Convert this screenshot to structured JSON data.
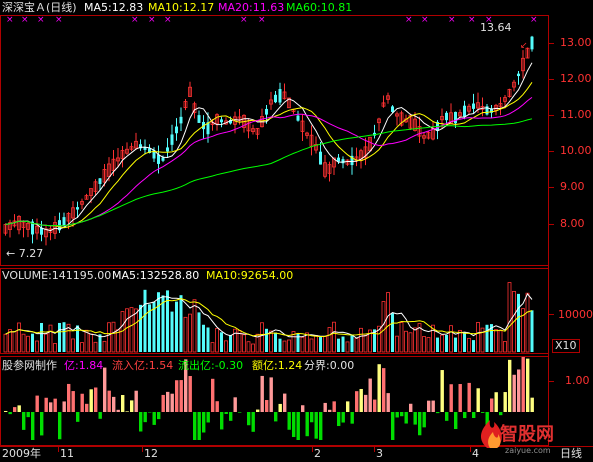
{
  "main_header": {
    "title": "深深宝Ａ(日线)",
    "ma5": "MA5:12.83",
    "ma10": "MA10:12.17",
    "ma20": "MA20:11.63",
    "ma60": "MA60:10.81"
  },
  "price_axis": [
    "13.00",
    "12.00",
    "11.00",
    "10.00",
    "9.00",
    "8.00"
  ],
  "annotations": {
    "high": "13.64",
    "low": "← 7.27"
  },
  "volume_header": {
    "volume": "VOLUME:141195.00",
    "ma5": "MA5:132528.80",
    "ma10": "MA10:92654.00"
  },
  "volume_axis": {
    "tick": "10000",
    "unit": "X10"
  },
  "flow_header": {
    "maker": "股参网制作",
    "yi": "亿:1.84",
    "inflow": "流入亿:1.54",
    "outflow": "流出亿:-0.30",
    "amount": "额亿:1.24",
    "boundary": "分界:0.00"
  },
  "flow_axis": {
    "tick": "1.00"
  },
  "date_axis": [
    "2009年",
    "11",
    "12",
    "2",
    "3",
    "4"
  ],
  "corner_label": "日线",
  "watermark": {
    "text": "智股网",
    "url": "zaiyue.com"
  },
  "colors": {
    "background": "#000000",
    "frame": "#b00000",
    "up": "#ff3232",
    "down": "#54fcfc",
    "ma5": "#ffffff",
    "ma10": "#ffff00",
    "ma20": "#ff00ff",
    "ma60": "#00ff00",
    "flow_in": "#ff7070",
    "flow_out": "#00dd00",
    "flow_pink": "#ff9999",
    "flow_yellow": "#ffff80"
  }
}
